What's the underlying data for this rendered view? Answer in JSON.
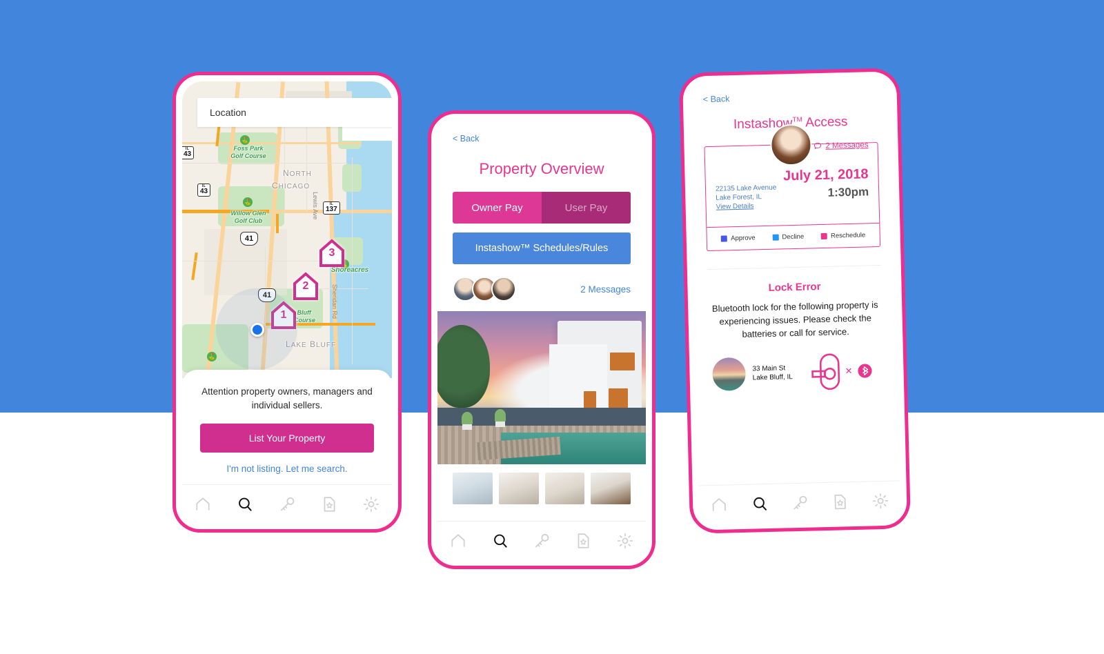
{
  "theme": {
    "background_blue": "#4285DC",
    "accent_pink": "#E8368F",
    "button_pink": "#D12F8F",
    "link_blue": "#4285DC"
  },
  "phone1": {
    "name": "map-search-screen",
    "search": {
      "value": "Location",
      "placeholder": "Location"
    },
    "map": {
      "labels": [
        {
          "text": "Foss Park\nGolf Course"
        },
        {
          "text": "Willow Glen\nGolf Club"
        },
        {
          "text": "Shoreacres"
        },
        {
          "text": "ke Bluff\nlf Course"
        }
      ],
      "towns": [
        "NORTH",
        "CHICAGO",
        "LAKE BLUFF"
      ],
      "streets": [
        "Lewis Ave",
        "Sheridan Rd"
      ],
      "route_shields": [
        "137",
        "137",
        "43",
        "43",
        "41",
        "41"
      ],
      "pins": [
        "3",
        "2",
        "1"
      ]
    },
    "sheet": {
      "message": "Attention property owners, managers and individual sellers.",
      "primary_button": "List Your Property",
      "secondary_link": "I'm not listing. Let me search."
    },
    "nav": [
      "home-icon",
      "search-icon",
      "key-icon",
      "document-star-icon",
      "gear-icon"
    ],
    "nav_active_index": 1
  },
  "phone2": {
    "name": "property-overview-screen",
    "back": "< Back",
    "title": "Property Overview",
    "segmented": {
      "selected": "Owner Pay",
      "unselected": "User Pay"
    },
    "schedules_button": "Instashow™ Schedules/Rules",
    "avatars": [
      "avatar-1",
      "avatar-2",
      "avatar-3"
    ],
    "messages_link": "2 Messages",
    "hero_image": "property-hero-photo",
    "thumbnails": [
      "thumb-living-room",
      "thumb-dining-room",
      "thumb-bedroom",
      "thumb-media-room"
    ],
    "nav": [
      "home-icon",
      "search-icon",
      "key-icon",
      "document-star-icon",
      "gear-icon"
    ],
    "nav_active_index": 1
  },
  "phone3": {
    "name": "instashow-access-screen",
    "back": "< Back",
    "title": "Instashow",
    "title_sup": "TM",
    "title_rest": " Access",
    "messages_link": "2 Messages",
    "appointment": {
      "date": "July 21, 2018",
      "time": "1:30pm",
      "address_line1": "22135 Lake Avenue",
      "address_line2": "Lake Forest, IL",
      "details_link": "View Details"
    },
    "legend": [
      {
        "label": "Approve",
        "color": "#4A55E0"
      },
      {
        "label": "Decline",
        "color": "#2196F3"
      },
      {
        "label": "Reschedule",
        "color": "#E8368F"
      }
    ],
    "lock_error": {
      "title": "Lock Error",
      "body": "Bluetooth lock for the following property is experiencing issues.  Please check the batteries or call for service.",
      "property_address_line1": "33 Main St",
      "property_address_line2": "Lake Bluff, IL",
      "icons": [
        "door-lock-icon",
        "x-icon",
        "bluetooth-icon"
      ]
    },
    "nav": [
      "home-icon",
      "search-icon",
      "key-icon",
      "document-star-icon",
      "gear-icon"
    ],
    "nav_active_index": 1
  }
}
